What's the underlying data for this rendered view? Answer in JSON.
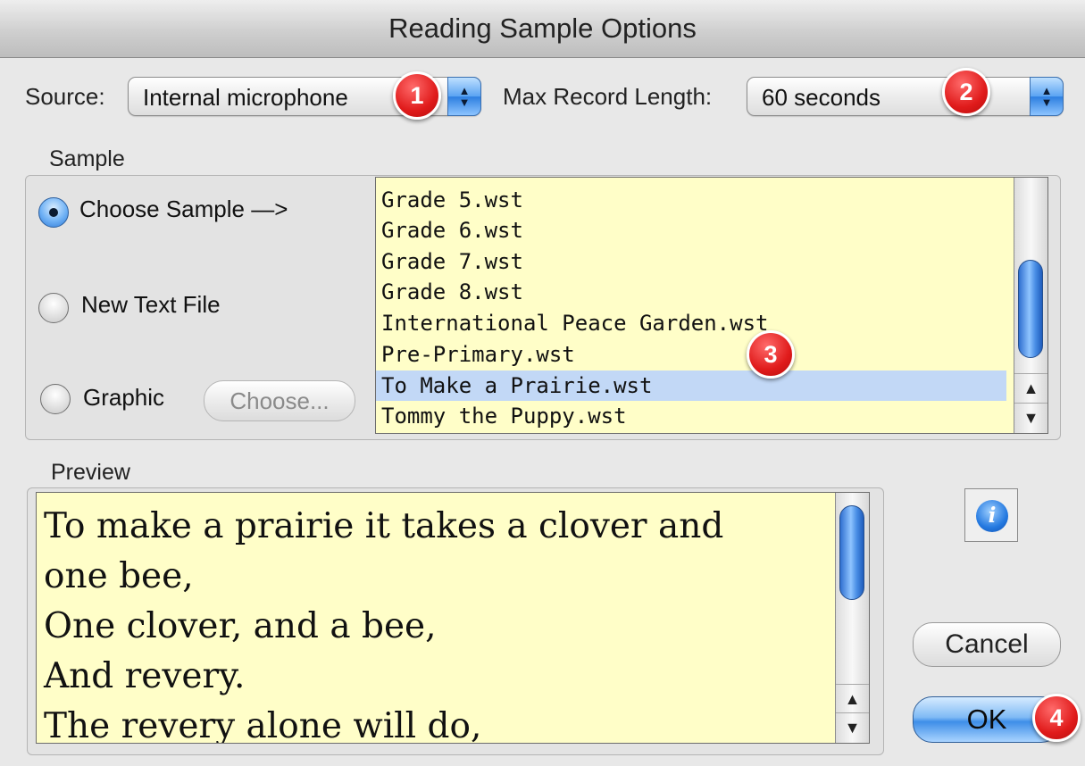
{
  "window": {
    "title": "Reading Sample Options"
  },
  "source": {
    "label": "Source:",
    "value": "Internal microphone"
  },
  "max_record": {
    "label": "Max Record Length:",
    "value": "60 seconds"
  },
  "sample": {
    "group_label": "Sample",
    "options": [
      {
        "label": "Choose Sample —>",
        "selected": true
      },
      {
        "label": "New Text File",
        "selected": false
      },
      {
        "label": "Graphic",
        "selected": false
      }
    ],
    "choose_button": "Choose...",
    "files": [
      "Grade 5.wst",
      "Grade 6.wst",
      "Grade 7.wst",
      "Grade 8.wst",
      "International Peace Garden.wst",
      "Pre-Primary.wst",
      "To Make a Prairie.wst",
      "Tommy the Puppy.wst"
    ],
    "selected_file": "To Make a Prairie.wst"
  },
  "preview": {
    "label": "Preview",
    "lines": [
      "To make a prairie it takes a clover and",
      "one bee,",
      "One clover, and a bee,",
      "And revery.",
      "The revery alone will do,"
    ]
  },
  "buttons": {
    "cancel": "Cancel",
    "ok": "OK"
  },
  "info": {
    "icon": "info-icon",
    "glyph": "i"
  },
  "badges": [
    "1",
    "2",
    "3",
    "4"
  ],
  "colors": {
    "list_bg": "#fffec8",
    "selection": "#c2d8f6",
    "badge": "#e01b1b",
    "accent": "#3e8ee8"
  }
}
